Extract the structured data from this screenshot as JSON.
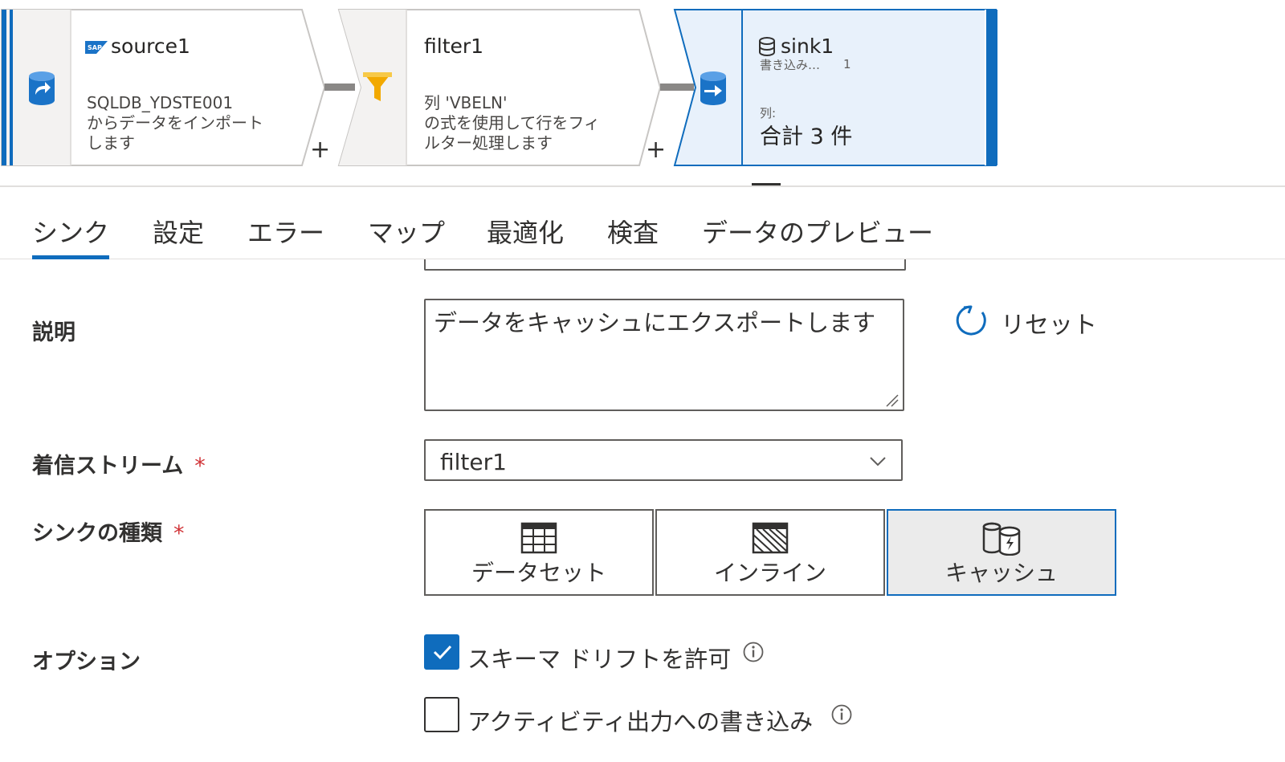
{
  "pipeline": {
    "source": {
      "title": "source1",
      "desc": "SQLDB_YDSTE001\nからデータをインポート\nします",
      "icon": "sap-logo-icon"
    },
    "filter": {
      "title": "filter1",
      "desc": "列 'VBELN'\nの式を使用して行をフィ\nルター処理します",
      "icon": "funnel-icon"
    },
    "sink": {
      "title": "sink1",
      "writes_label": "書き込み…",
      "writes_count": "1",
      "columns_label": "列:",
      "columns_total": "合計 3 件"
    },
    "add_symbol": "+"
  },
  "tabs": [
    {
      "label": "シンク",
      "active": true
    },
    {
      "label": "設定"
    },
    {
      "label": "エラー"
    },
    {
      "label": "マップ"
    },
    {
      "label": "最適化"
    },
    {
      "label": "検査"
    },
    {
      "label": "データのプレビュー"
    }
  ],
  "form": {
    "description": {
      "label": "説明",
      "value": "データをキャッシュにエクスポートします"
    },
    "reset_label": "リセット",
    "incoming_stream": {
      "label": "着信ストリーム",
      "required": "*",
      "value": "filter1"
    },
    "sink_type": {
      "label": "シンクの種類",
      "required": "*",
      "options": [
        {
          "label": "データセット",
          "icon": "table-grid-icon"
        },
        {
          "label": "インライン",
          "icon": "inline-hatch-icon"
        },
        {
          "label": "キャッシュ",
          "icon": "cache-icon",
          "selected": true
        }
      ]
    },
    "options": {
      "label": "オプション",
      "allow_schema_drift": {
        "label": "スキーマ ドリフトを許可",
        "checked": true
      },
      "write_activity_output": {
        "label": "アクティビティ出力への書き込み",
        "checked": false
      }
    }
  },
  "colors": {
    "accent": "#0f6cbd",
    "sink_fill": "#e8f1fb",
    "node_fill": "#f3f2f1",
    "filter_icon": "#f2a900",
    "db_icon": "#1a73c7",
    "required": "#d13438"
  }
}
